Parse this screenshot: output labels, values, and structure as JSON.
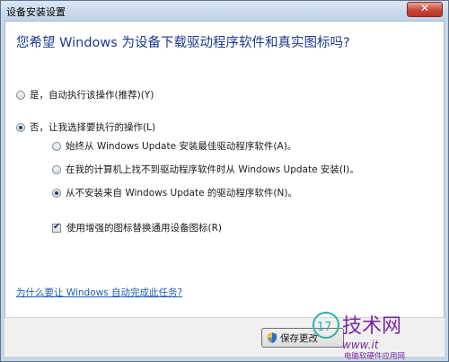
{
  "window": {
    "title": "设备安装设置",
    "close_glyph": "✕"
  },
  "heading": "您希望 Windows 为设备下载驱动程序软件和真实图标吗?",
  "options": {
    "yes_auto": "是，自动执行该操作(推荐)(Y)",
    "no_choose": "否，让我选择要执行的操作(L)",
    "sub1": "始终从 Windows Update 安装最佳驱动程序软件(A)。",
    "sub2": "在我的计算机上找不到驱动程序软件时从 Windows Update 安装(I)。",
    "sub3": "从不安装来自 Windows Update 的驱动程序软件(N)。",
    "checkbox": "使用增强的图标替换通用设备图标(R)"
  },
  "link": "为什么要让 Windows 自动完成此任务?",
  "footer": {
    "save_label": "保存更改"
  },
  "watermark": {
    "brand": "技术网",
    "number": "17",
    "site": "www.it",
    "subtitle": "电脑软硬件应用网"
  },
  "colors": {
    "heading": "#1e3a8a",
    "link": "#1d5bb5",
    "watermark": "#7a2aa0"
  }
}
